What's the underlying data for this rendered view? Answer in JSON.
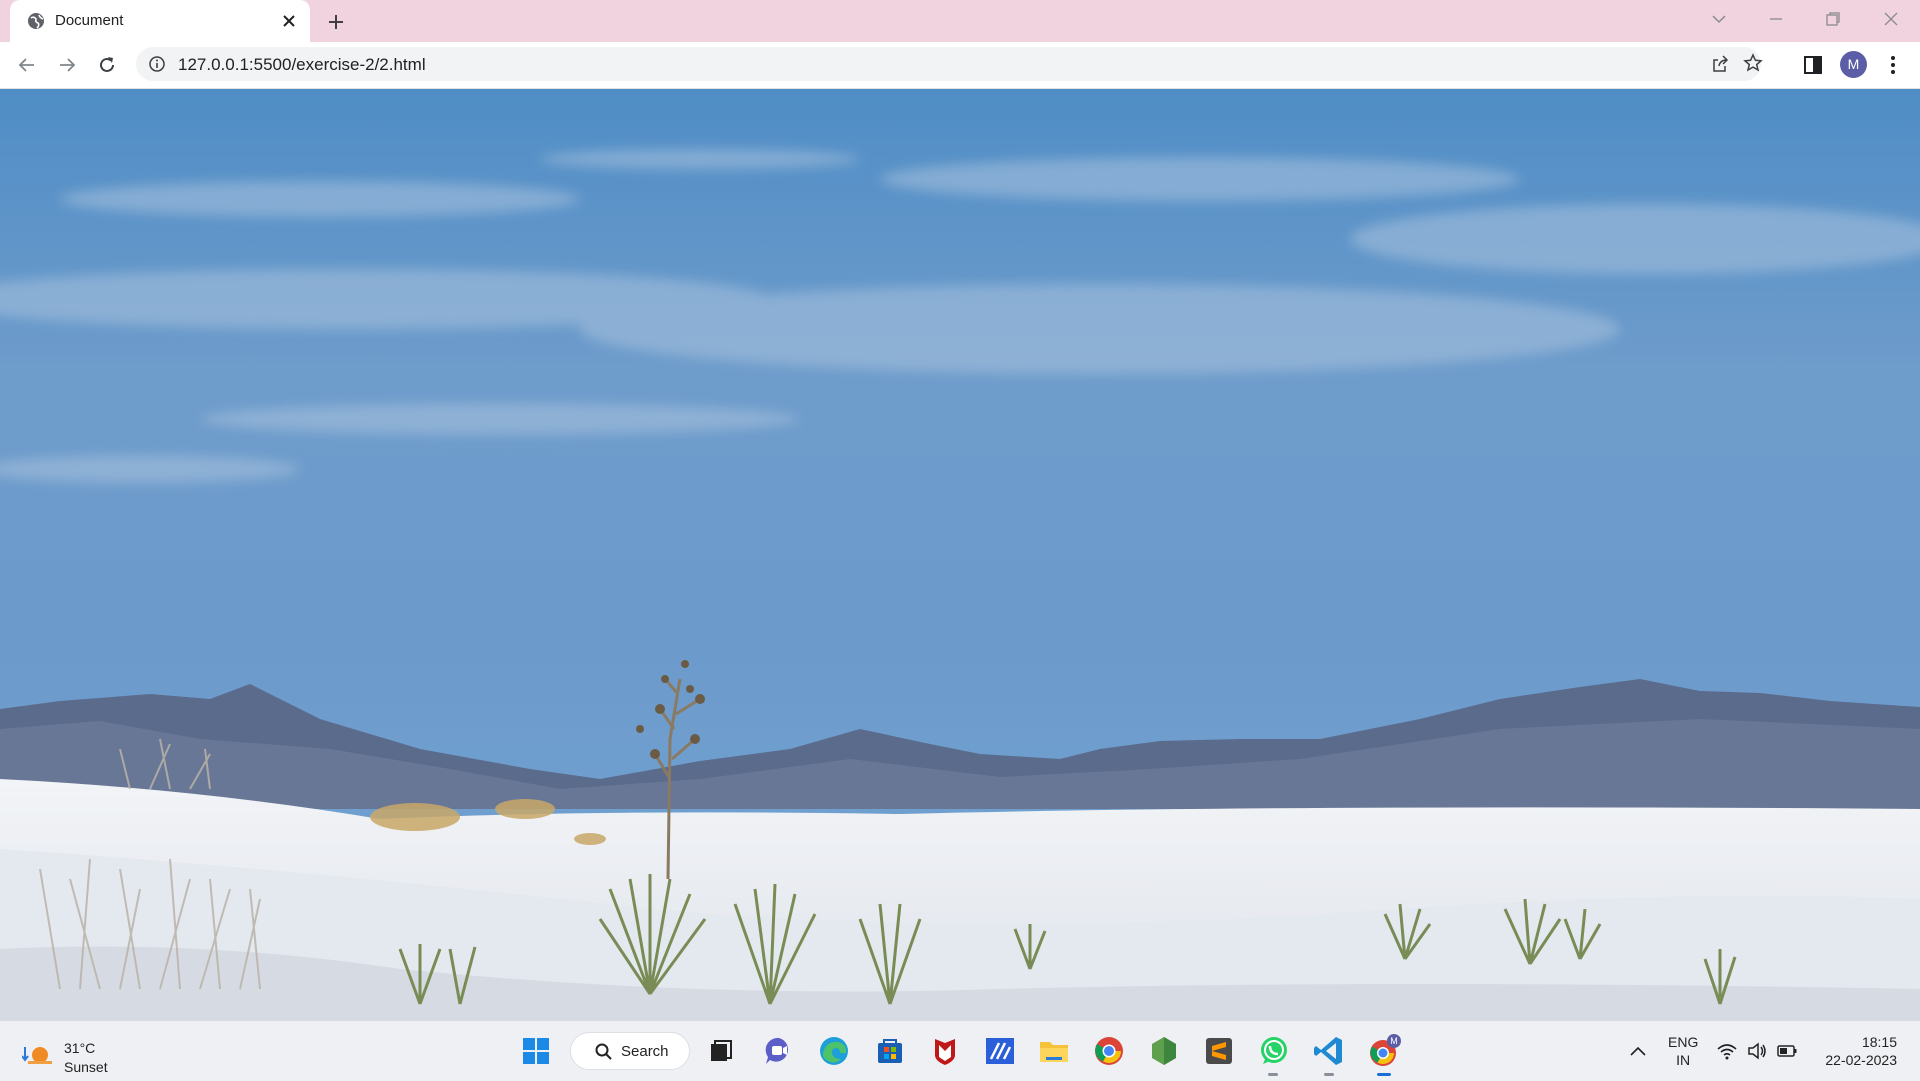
{
  "browser": {
    "tab_title": "Document",
    "url": "127.0.0.1:5500/exercise-2/2.html",
    "profile_initial": "M",
    "accent_tabbar": "#f1d3e0"
  },
  "page": {
    "content": "landscape photo: white sand dunes with yucca plants under a blue sky with mountains"
  },
  "taskbar": {
    "weather_temp": "31°C",
    "weather_condition": "Sunset",
    "search_label": "Search",
    "apps": [
      "start-icon",
      "search",
      "task-view-icon",
      "teams-chat-icon",
      "edge-icon",
      "store-icon",
      "mcafee-icon",
      "visual-studio-icon",
      "file-explorer-icon",
      "chrome-icon",
      "nodejs-icon",
      "sublime-text-icon",
      "whatsapp-icon",
      "vscode-icon",
      "chrome-profile-icon"
    ],
    "lang_line1": "ENG",
    "lang_line2": "IN",
    "time": "18:15",
    "date": "22-02-2023"
  }
}
